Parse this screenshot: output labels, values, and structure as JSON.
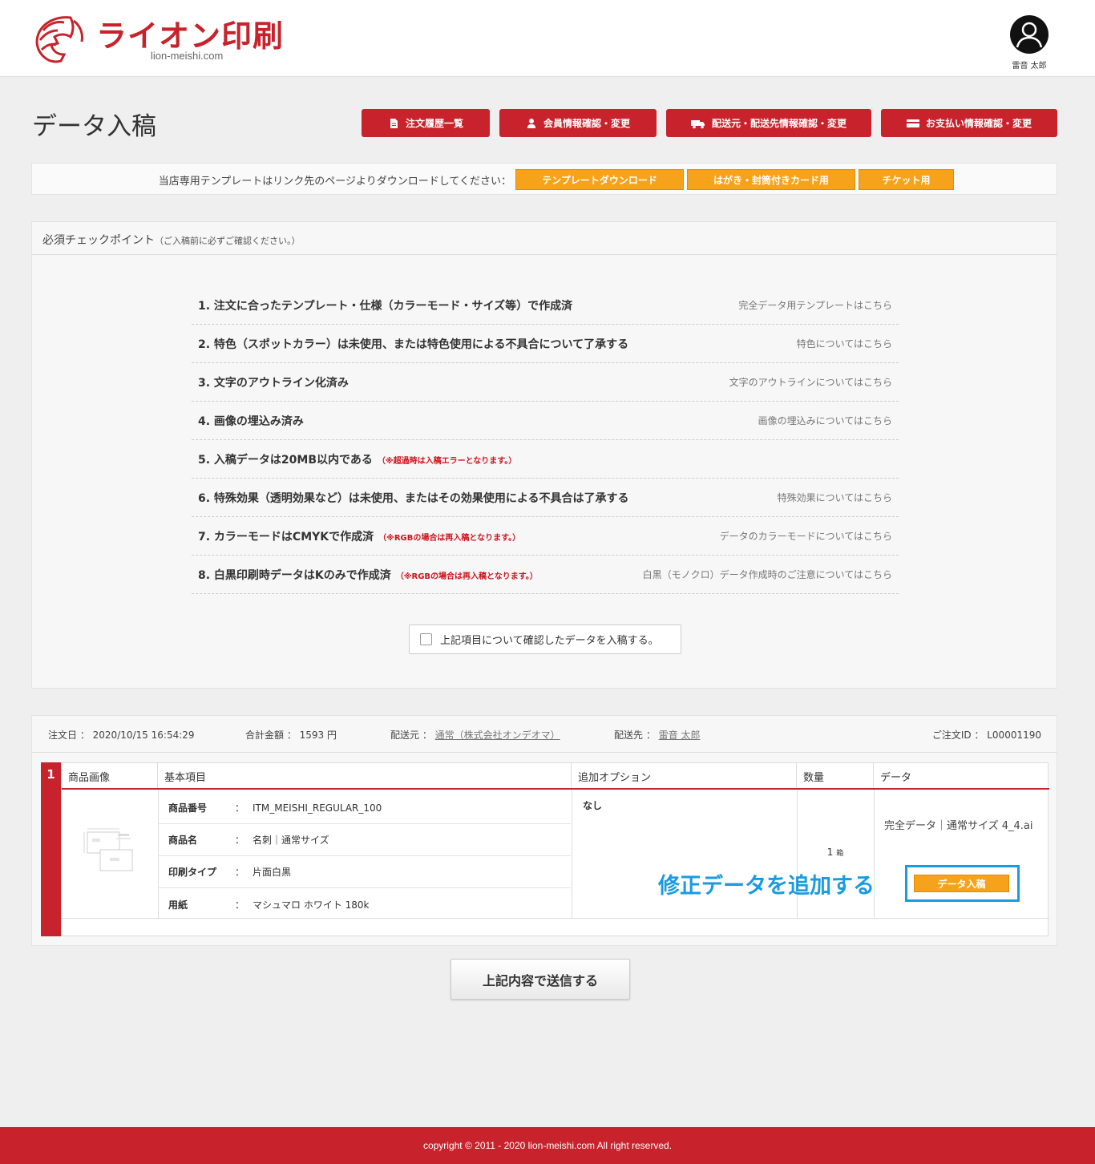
{
  "header": {
    "logo_text": "ライオン印刷",
    "logo_sub": "lion-meishi.com",
    "user_name": "雷音 太郎"
  },
  "page_title": "データ入稿",
  "nav": [
    {
      "label": "注文履歴一覧",
      "icon": "document-icon"
    },
    {
      "label": "会員情報確認・変更",
      "icon": "user-icon"
    },
    {
      "label": "配送元・配送先情報確認・変更",
      "icon": "truck-icon"
    },
    {
      "label": "お支払い情報確認・変更",
      "icon": "card-icon"
    }
  ],
  "template_bar": {
    "text": "当店専用テンプレートはリンク先のページよりダウンロードしてください：",
    "buttons": [
      "テンプレートダウンロード",
      "はがき・封筒付きカード用",
      "チケット用"
    ]
  },
  "checkpoints": {
    "title": "必須チェックポイント",
    "title_note": "（ご入稿前に必ずご確認ください。）",
    "items": [
      {
        "label": "1. 注文に合ったテンプレート・仕様（カラーモード・サイズ等）で作成済",
        "note": "",
        "link": "完全データ用テンプレートはこちら"
      },
      {
        "label": "2. 特色（スポットカラー）は未使用、または特色使用による不具合について了承する",
        "note": "",
        "link": "特色についてはこちら"
      },
      {
        "label": "3. 文字のアウトライン化済み",
        "note": "",
        "link": "文字のアウトラインについてはこちら"
      },
      {
        "label": "4. 画像の埋込み済み",
        "note": "",
        "link": "画像の埋込みについてはこちら"
      },
      {
        "label": "5. 入稿データは20MB以内である",
        "note": "（※超過時は入稿エラーとなります。）",
        "link": ""
      },
      {
        "label": "6. 特殊効果（透明効果など）は未使用、またはその効果使用による不具合は了承する",
        "note": "",
        "link": "特殊効果についてはこちら"
      },
      {
        "label": "7. カラーモードはCMYKで作成済",
        "note": "（※RGBの場合は再入稿となります。）",
        "link": "データのカラーモードについてはこちら"
      },
      {
        "label": "8. 白黒印刷時データはKのみで作成済",
        "note": "（※RGBの場合は再入稿となります。）",
        "link": "白黒（モノクロ）データ作成時のご注意についてはこちら"
      }
    ],
    "confirm_label": "上記項目について確認したデータを入稿する。"
  },
  "order": {
    "date_label": "注文日",
    "date": "2020/10/15 16:54:29",
    "total_label": "合計金額",
    "total": "1593 円",
    "from_label": "配送元",
    "from": "通常（株式会社オンデオマ）",
    "to_label": "配送先",
    "to": "雷音 太郎",
    "id_label": "ご注文ID",
    "id": "L00001190",
    "item_number": "1",
    "columns": [
      "商品画像",
      "基本項目",
      "追加オプション",
      "数量",
      "データ"
    ],
    "specs": [
      {
        "key": "商品番号",
        "value": "ITM_MEISHI_REGULAR_100"
      },
      {
        "key": "商品名",
        "value": "名刺｜通常サイズ"
      },
      {
        "key": "印刷タイプ",
        "value": "片面白黒"
      },
      {
        "key": "用紙",
        "value": "マシュマロ ホワイト 180k"
      }
    ],
    "option": "なし",
    "quantity": "1",
    "quantity_unit": "箱",
    "data_file": "完全データ｜通常サイズ 4_4.ai",
    "data_button": "データ入稿",
    "annotation": "修正データを追加する"
  },
  "submit_label": "上記内容で送信する",
  "footer": "copyright © 2011 - 2020 lion-meishi.com All right reserved.",
  "colors": {
    "brand": "#c8232c",
    "accent": "#f7a21b",
    "highlight": "#1a9be0"
  }
}
